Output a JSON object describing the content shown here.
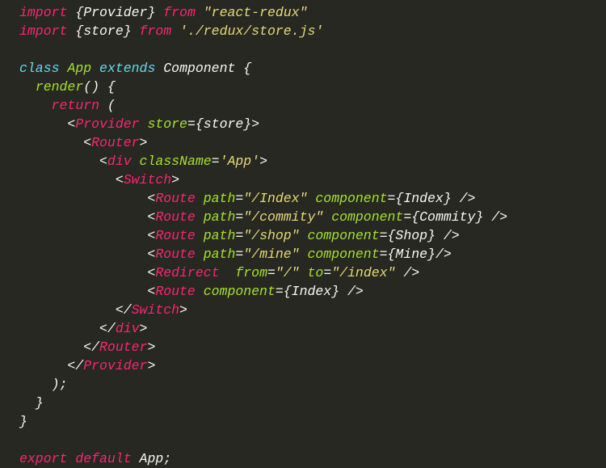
{
  "t": {
    "import1a": "import",
    "import1b": " {Provider} ",
    "import1c": "from",
    "import1d": " ",
    "import1e": "\"react-redux\"",
    "import2a": "import",
    "import2b": " {store} ",
    "import2c": "from",
    "import2d": " ",
    "import2e": "'./redux/store.js'",
    "blank": "",
    "class1": "class",
    "class2": " ",
    "class3": "App",
    "class4": " ",
    "class5": "extends",
    "class6": " ",
    "class7": "Component",
    "class8": " {",
    "render1": "  ",
    "render2": "render",
    "render3": "() {",
    "return1": "    ",
    "return2": "return",
    "return3": " (",
    "prov1a": "      <",
    "prov1b": "Provider",
    "prov1c": " ",
    "prov1d": "store",
    "prov1e": "=",
    "prov1f": "{store}",
    "prov1g": ">",
    "router1a": "        <",
    "router1b": "Router",
    "router1c": ">",
    "div1a": "          <",
    "div1b": "div",
    "div1c": " ",
    "div1d": "className",
    "div1e": "=",
    "div1f": "'App'",
    "div1g": ">",
    "sw1a": "            <",
    "sw1b": "Switch",
    "sw1c": ">",
    "r1ind": "                <",
    "r1tag": "Route",
    "r1sp": " ",
    "r1pa": "path",
    "r1eq": "=",
    "r1pv": "\"/Index\"",
    "r1sp2": " ",
    "r1ca": "component",
    "r1eq2": "=",
    "r1cv": "{Index}",
    "r1cl": " />",
    "r2ind": "                <",
    "r2tag": "Route",
    "r2sp": " ",
    "r2pa": "path",
    "r2eq": "=",
    "r2pv": "\"/commity\"",
    "r2sp2": " ",
    "r2ca": "component",
    "r2eq2": "=",
    "r2cv": "{Commity}",
    "r2cl": " />",
    "r3ind": "                <",
    "r3tag": "Route",
    "r3sp": " ",
    "r3pa": "path",
    "r3eq": "=",
    "r3pv": "\"/shop\"",
    "r3sp2": " ",
    "r3ca": "component",
    "r3eq2": "=",
    "r3cv": "{Shop}",
    "r3cl": " />",
    "r4ind": "                <",
    "r4tag": "Route",
    "r4sp": " ",
    "r4pa": "path",
    "r4eq": "=",
    "r4pv": "\"/mine\"",
    "r4sp2": " ",
    "r4ca": "component",
    "r4eq2": "=",
    "r4cv": "{Mine}",
    "r4cl": "/>",
    "rd1ind": "                <",
    "rd1tag": "Redirect",
    "rd1sp": "  ",
    "rd1fa": "from",
    "rd1eq": "=",
    "rd1fv": "\"/\"",
    "rd1sp2": " ",
    "rd1ta": "to",
    "rd1eq2": "=",
    "rd1tv": "\"/index\"",
    "rd1cl": " />",
    "r5ind": "                <",
    "r5tag": "Route",
    "r5sp": " ",
    "r5ca": "component",
    "r5eq": "=",
    "r5cv": "{Index}",
    "r5cl": " />",
    "sw2a": "            </",
    "sw2b": "Switch",
    "sw2c": ">",
    "div2a": "          </",
    "div2b": "div",
    "div2c": ">",
    "router2a": "        </",
    "router2b": "Router",
    "router2c": ">",
    "prov2a": "      </",
    "prov2b": "Provider",
    "prov2c": ">",
    "close1": "    );",
    "close2": "  }",
    "close3": "}",
    "exp1": "export",
    "exp2": " ",
    "exp3": "default",
    "exp4": " App;"
  }
}
